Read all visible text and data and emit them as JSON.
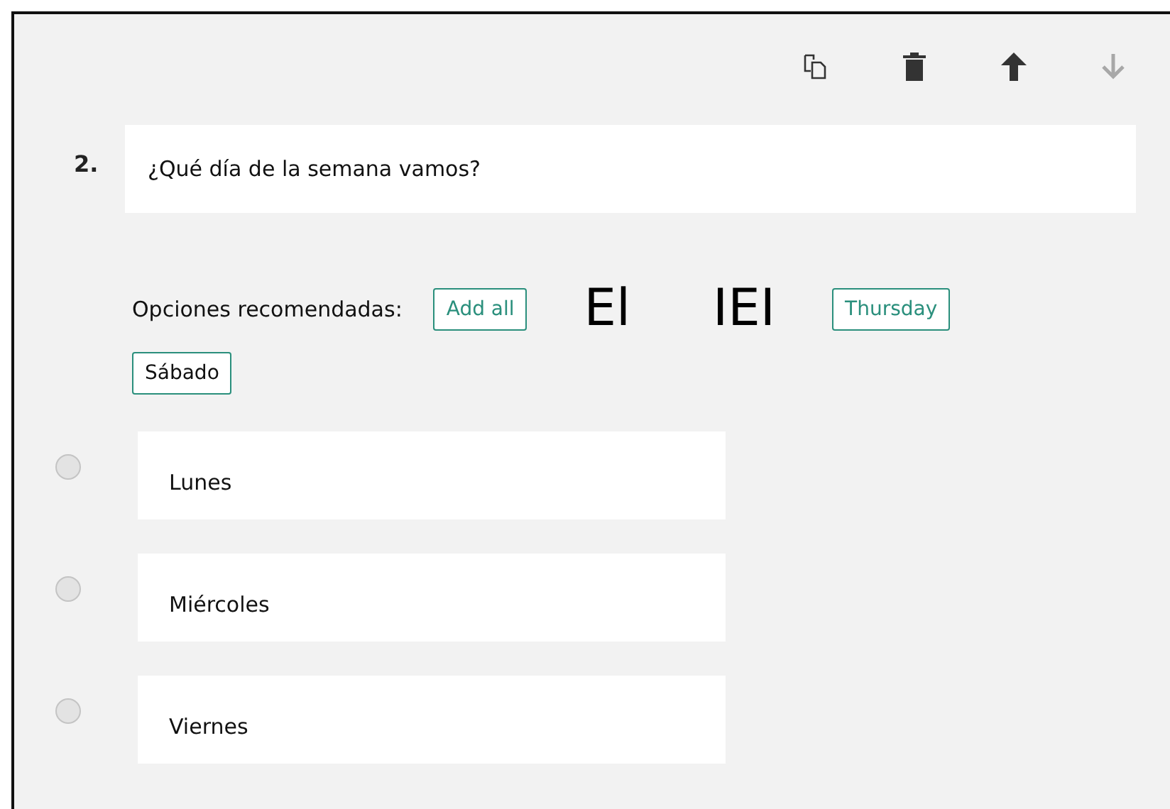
{
  "toolbar": [
    {
      "kind": "copy",
      "disabled": false
    },
    {
      "kind": "delete",
      "disabled": false
    },
    {
      "kind": "move-up",
      "disabled": false
    },
    {
      "kind": "move-down",
      "disabled": true
    }
  ],
  "question": {
    "number": "2.",
    "text": "¿Qué día de la semana vamos?"
  },
  "suggestions": {
    "label": "Opciones recomendadas:",
    "items": [
      {
        "kind": "button",
        "text": "Add all"
      },
      {
        "kind": "glyph",
        "text": "El"
      },
      {
        "kind": "glyph",
        "text": "IEI"
      },
      {
        "kind": "button",
        "text": "Thursday"
      },
      {
        "kind": "option",
        "text": "Sábado"
      }
    ]
  },
  "options": [
    {
      "text": "Lunes",
      "selected": false
    },
    {
      "text": "Miércoles",
      "selected": false
    },
    {
      "text": "Viernes",
      "selected": false
    }
  ]
}
